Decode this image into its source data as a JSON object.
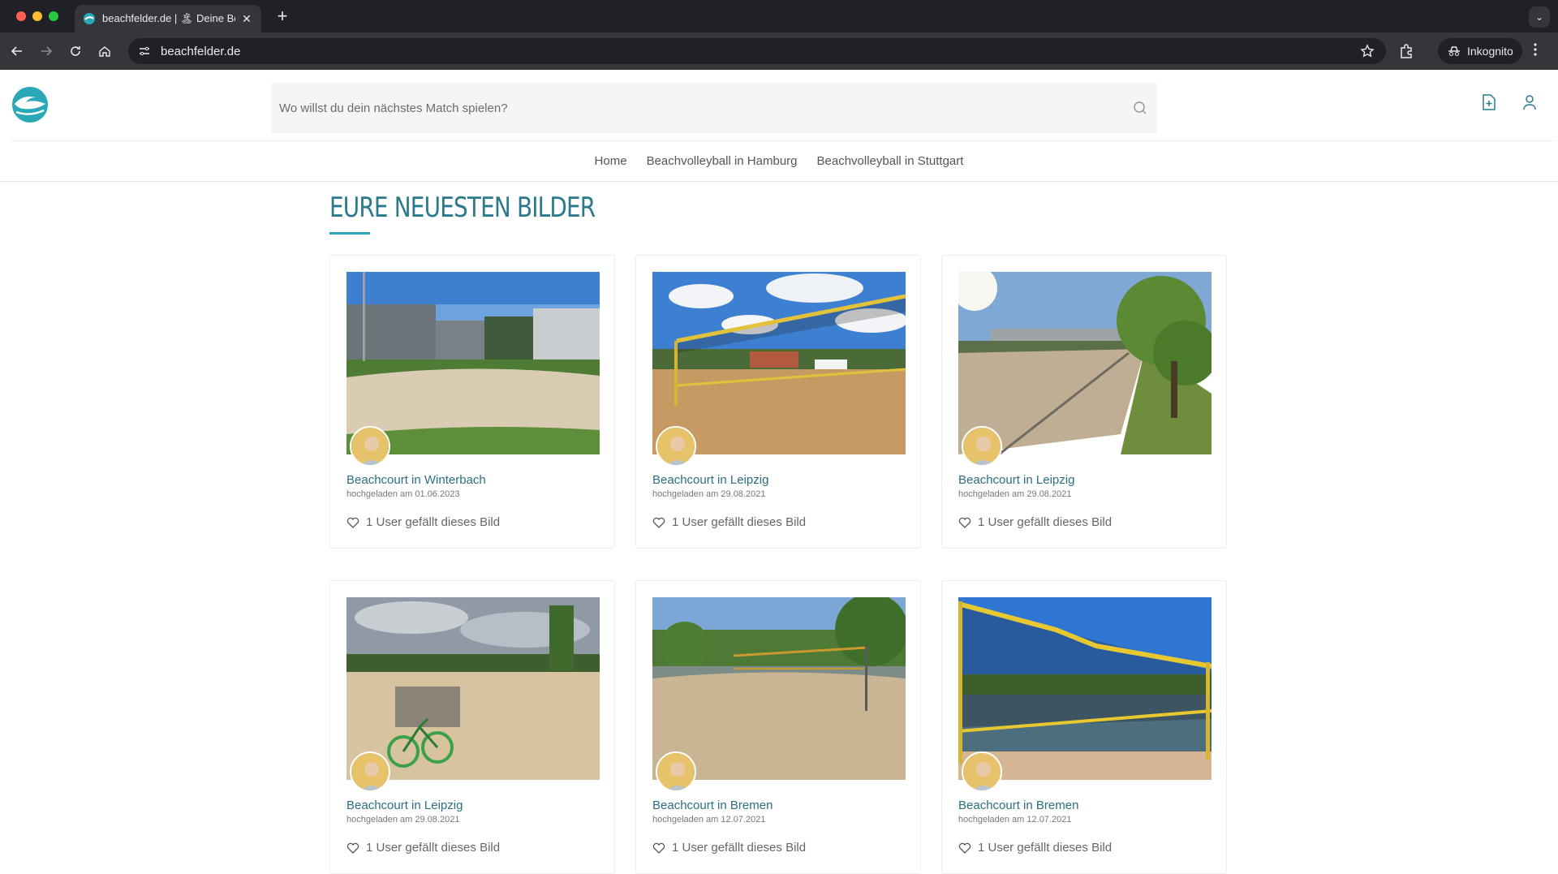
{
  "browser": {
    "tab_title": "beachfelder.de | 🏝 Deine Be",
    "new_tab": "+",
    "tab_menu": "⌄",
    "url": "beachfelder.de",
    "incognito_label": "Inkognito"
  },
  "header": {
    "search_placeholder": "Wo willst du dein nächstes Match spielen?",
    "nav": [
      {
        "label": "Home"
      },
      {
        "label": "Beachvolleyball in Hamburg"
      },
      {
        "label": "Beachvolleyball in Stuttgart"
      }
    ]
  },
  "main": {
    "title": "EURE NEUESTEN BILDER",
    "cards": [
      {
        "title": "Beachcourt in Winterbach",
        "date": "hochgeladen am 01.06.2023",
        "likes": "1 User gefällt dieses Bild"
      },
      {
        "title": "Beachcourt in Leipzig",
        "date": "hochgeladen am 29.08.2021",
        "likes": "1 User gefällt dieses Bild"
      },
      {
        "title": "Beachcourt in Leipzig",
        "date": "hochgeladen am 29.08.2021",
        "likes": "1 User gefällt dieses Bild"
      },
      {
        "title": "Beachcourt in Leipzig",
        "date": "hochgeladen am 29.08.2021",
        "likes": "1 User gefällt dieses Bild"
      },
      {
        "title": "Beachcourt in Bremen",
        "date": "hochgeladen am 12.07.2021",
        "likes": "1 User gefällt dieses Bild"
      },
      {
        "title": "Beachcourt in Bremen",
        "date": "hochgeladen am 12.07.2021",
        "likes": "1 User gefällt dieses Bild"
      }
    ]
  },
  "colors": {
    "accent": "#2aa8b8",
    "title": "#2b7a8c",
    "card_title": "#2b6f80"
  },
  "icons": [
    "favicon-icon",
    "close-icon",
    "back-icon",
    "forward-icon",
    "reload-icon",
    "home-icon",
    "site-settings-icon",
    "star-icon",
    "extensions-icon",
    "incognito-icon",
    "menu-icon",
    "logo-icon",
    "search-icon",
    "add-document-icon",
    "user-icon",
    "heart-icon"
  ]
}
